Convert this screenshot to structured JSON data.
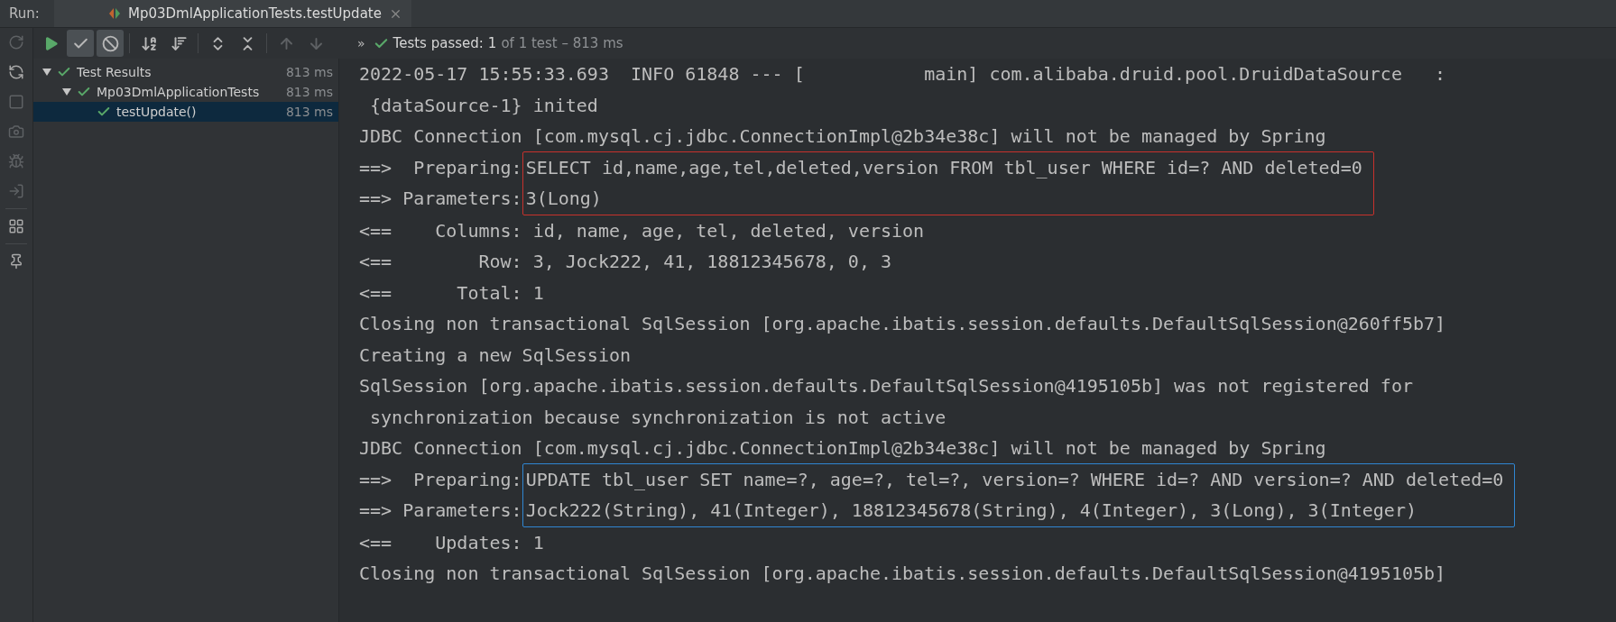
{
  "run_bar": {
    "label": "Run:",
    "tab": {
      "title": "Mp03DmlApplicationTests.testUpdate",
      "selected": true
    }
  },
  "toolbar": {
    "buttons": [
      {
        "kind": "run",
        "on": false,
        "disabled": false
      },
      {
        "kind": "show-passed",
        "on": true,
        "disabled": false
      },
      {
        "kind": "show-ignored",
        "on": true,
        "disabled": false
      },
      {
        "kind": "sort-alpha",
        "on": false,
        "disabled": false
      },
      {
        "kind": "sort-duration",
        "on": false,
        "disabled": false
      },
      {
        "kind": "expand-all",
        "on": false,
        "disabled": false
      },
      {
        "kind": "collapse-all",
        "on": false,
        "disabled": false
      },
      {
        "kind": "up",
        "on": false,
        "disabled": true
      },
      {
        "kind": "down",
        "on": false,
        "disabled": true
      }
    ],
    "more": "»",
    "status": {
      "label": "Tests passed:",
      "count": "1",
      "detail": "of 1 test – 813 ms"
    }
  },
  "side_strip": [
    {
      "kind": "rerun-failed",
      "disabled": true
    },
    {
      "kind": "auto-rerun",
      "disabled": false
    },
    {
      "kind": "stop",
      "disabled": true
    },
    {
      "kind": "camera",
      "disabled": true
    },
    {
      "kind": "bug",
      "disabled": true
    },
    {
      "kind": "import",
      "disabled": true
    },
    {
      "kind": "layout",
      "disabled": false
    },
    {
      "kind": "pin",
      "disabled": false
    }
  ],
  "tree": [
    {
      "label": "Test Results",
      "time": "813 ms",
      "expanded": true,
      "selected": false,
      "children": [
        {
          "label": "Mp03DmlApplicationTests",
          "time": "813 ms",
          "expanded": true,
          "selected": false,
          "children": [
            {
              "label": "testUpdate()",
              "time": "813 ms",
              "selected": true
            }
          ]
        }
      ]
    }
  ],
  "console": [
    {
      "kind": "line",
      "text": "2022-05-17 15:55:33.693  INFO 61848 --- [           main] com.alibaba.druid.pool.DruidDataSource   :"
    },
    {
      "kind": "line",
      "text": " {dataSource-1} inited"
    },
    {
      "kind": "line",
      "text": "JDBC Connection [com.mysql.cj.jdbc.ConnectionImpl@2b34e38c] will not be managed by Spring"
    },
    {
      "kind": "group",
      "color": "#c7312c",
      "lines": [
        {
          "prefix": "==>  Preparing:",
          "text": "SELECT id,name,age,tel,deleted,version FROM tbl_user WHERE id=? AND deleted=0"
        },
        {
          "prefix": "==> Parameters:",
          "text": "3(Long)"
        }
      ]
    },
    {
      "kind": "line",
      "text": "<==    Columns: id, name, age, tel, deleted, version"
    },
    {
      "kind": "line",
      "text": "<==        Row: 3, Jock222, 41, 18812345678, 0, 3"
    },
    {
      "kind": "line",
      "text": "<==      Total: 1"
    },
    {
      "kind": "line",
      "text": "Closing non transactional SqlSession [org.apache.ibatis.session.defaults.DefaultSqlSession@260ff5b7]"
    },
    {
      "kind": "line",
      "text": "Creating a new SqlSession"
    },
    {
      "kind": "line",
      "text": "SqlSession [org.apache.ibatis.session.defaults.DefaultSqlSession@4195105b] was not registered for"
    },
    {
      "kind": "line",
      "text": " synchronization because synchronization is not active"
    },
    {
      "kind": "line",
      "text": "JDBC Connection [com.mysql.cj.jdbc.ConnectionImpl@2b34e38c] will not be managed by Spring"
    },
    {
      "kind": "group",
      "color": "#2f86d2",
      "lines": [
        {
          "prefix": "==>  Preparing:",
          "text": "UPDATE tbl_user SET name=?, age=?, tel=?, version=? WHERE id=? AND version=? AND deleted=0"
        },
        {
          "prefix": "==> Parameters:",
          "text": "Jock222(String), 41(Integer), 18812345678(String), 4(Integer), 3(Long), 3(Integer)"
        }
      ]
    },
    {
      "kind": "line",
      "text": "<==    Updates: 1"
    },
    {
      "kind": "line",
      "text": "Closing non transactional SqlSession [org.apache.ibatis.session.defaults.DefaultSqlSession@4195105b]"
    }
  ]
}
